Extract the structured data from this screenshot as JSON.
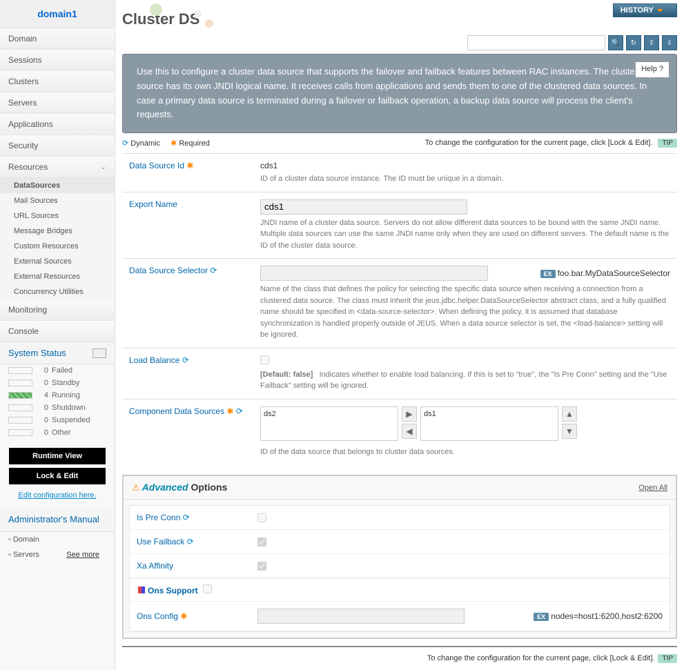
{
  "sidebar": {
    "title": "domain1",
    "nav": [
      "Domain",
      "Sessions",
      "Clusters",
      "Servers",
      "Applications",
      "Security",
      "Resources"
    ],
    "resources_sub": [
      "DataSources",
      "Mail Sources",
      "URL Sources",
      "Message Bridges",
      "Custom Resources",
      "External Sources",
      "External Resources",
      "Concurrency Utilities"
    ],
    "nav2": [
      "Monitoring",
      "Console"
    ],
    "system_status_title": "System Status",
    "status": [
      {
        "count": "0",
        "label": "Failed"
      },
      {
        "count": "0",
        "label": "Standby"
      },
      {
        "count": "4",
        "label": "Running"
      },
      {
        "count": "0",
        "label": "Shutdown"
      },
      {
        "count": "0",
        "label": "Suspended"
      },
      {
        "count": "0",
        "label": "Other"
      }
    ],
    "runtime_btn": "Runtime View",
    "lock_btn": "Lock & Edit",
    "edit_link": "Edit configuration here.",
    "manual_title": "Administrator's Manual",
    "manual_items": [
      "Domain",
      "Servers"
    ],
    "see_more": "See more"
  },
  "header": {
    "history": "HISTORY",
    "title": "Cluster DS"
  },
  "banner": {
    "text": "Use this to configure a cluster data source that supports the failover and failback features between RAC instances. The cluster data source has its own JNDI logical name. It receives calls from applications and sends them to one of the clustered data sources. In case a primary data source is terminated during a failover or failback operation, a backup data source will process the client's requests.",
    "help": "Help"
  },
  "legend": {
    "dynamic": "Dynamic",
    "required": "Required",
    "tip_text": "To change the configuration for the current page, click [Lock & Edit].",
    "tip": "TIP"
  },
  "form": {
    "dsid": {
      "label": "Data Source Id",
      "value": "cds1",
      "desc": "ID of a cluster data source instance. The ID must be unique in a domain."
    },
    "export": {
      "label": "Export Name",
      "value": "cds1",
      "desc": "JNDI name of a cluster data source. Servers do not allow different data sources to be bound with the same JNDI name. Multiple data sources can use the same JNDI name only when they are used on different servers. The default name is the ID of the cluster data source."
    },
    "selector": {
      "label": "Data Source Selector",
      "example": "foo.bar.MyDataSourceSelector",
      "desc": "Name of the class that defines the policy for selecting the specific data source when receiving a connection from a clustered data source. The class must inherit the jeus.jdbc.helper.DataSourceSelector abstract class, and a fully qualified name should be specified in <data-source-selector>. When defining the policy, it is assumed that database synchronization is handled properly outside of JEUS. When a data source selector is set, the <load-balance> setting will be ignored."
    },
    "loadbalance": {
      "label": "Load Balance",
      "default": "[Default: false]",
      "desc": "Indicates whether to enable load balancing. If this is set to \"true\", the \"Is Pre Conn\" setting and the \"Use Failback\" setting will be ignored."
    },
    "components": {
      "label": "Component Data Sources",
      "left": "ds2",
      "right": "ds1",
      "desc": "ID of the data source that belongs to cluster data sources."
    }
  },
  "advanced": {
    "title_adv": "Advanced",
    "title_opt": "Options",
    "open_all": "Open All",
    "preconn": "Is Pre Conn",
    "failback": "Use Failback",
    "affinity": "Xa Affinity",
    "ons_support": "Ons Support",
    "ons_config": "Ons Config",
    "ons_example": "nodes=host1:6200,host2:6200"
  },
  "footer": {
    "text": "To change the configuration for the current page, click [Lock & Edit].",
    "tip": "TIP"
  }
}
